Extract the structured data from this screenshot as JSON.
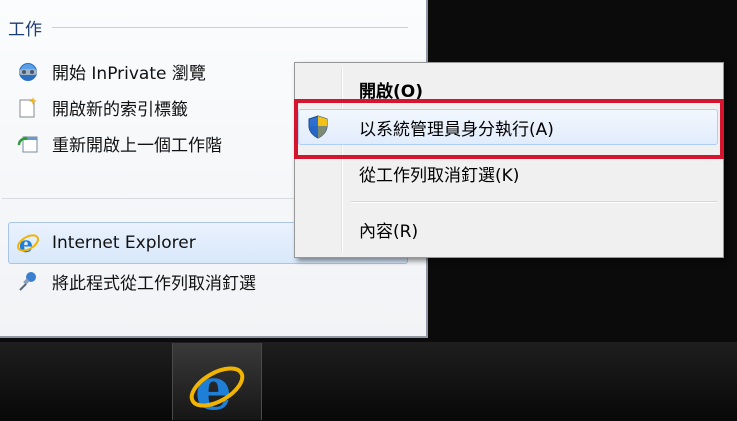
{
  "jumplist": {
    "section_title": "工作",
    "tasks": [
      {
        "label": "開始 InPrivate 瀏覽",
        "icon": "inprivate-icon"
      },
      {
        "label": "開啟新的索引標籤",
        "icon": "new-tab-icon"
      },
      {
        "label": "重新開啟上一個工作階",
        "icon": "reopen-session-icon"
      }
    ],
    "pinned_program": {
      "label": "Internet Explorer",
      "icon": "ie-icon"
    },
    "unpin_action": {
      "label": "將此程式從工作列取消釘選",
      "icon": "unpin-icon"
    }
  },
  "context_menu": {
    "items": [
      {
        "label": "開啟(O)",
        "bold": true
      },
      {
        "label": "以系統管理員身分執行(A)",
        "icon": "uac-shield-icon",
        "highlighted": true
      },
      {
        "label": "從工作列取消釘選(K)"
      },
      {
        "label": "內容(R)"
      }
    ]
  },
  "taskbar": {
    "active_program_icon": "ie-icon"
  },
  "colors": {
    "highlight_border": "#d5142d",
    "ie_blue": "#1f7fd6",
    "ie_ring": "#f1b400"
  }
}
